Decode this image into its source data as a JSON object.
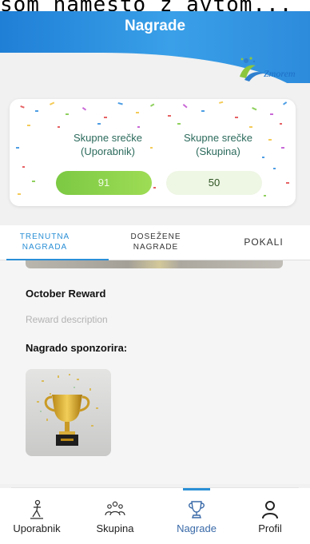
{
  "notification": {
    "text": "som namesto z avtom..."
  },
  "header": {
    "title": "Nagrade"
  },
  "logo": {
    "text": "Zmorem"
  },
  "points": {
    "user": {
      "label": "Skupne srečke\n(Uporabnik)",
      "value": "91"
    },
    "group": {
      "label": "Skupne srečke\n(Skupina)",
      "value": "50"
    }
  },
  "tabs": [
    {
      "label": "TRENUTNA\nNAGRADA",
      "active": true
    },
    {
      "label": "DOSEŽENE\nNAGRADE",
      "active": false
    },
    {
      "label": "POKALI",
      "active": false
    }
  ],
  "reward": {
    "title": "October Reward",
    "description": "Reward description",
    "sponsor_label": "Nagrado sponzorira:"
  },
  "nav": [
    {
      "label": "Uporabnik",
      "icon": "user-icon",
      "active": false
    },
    {
      "label": "Skupina",
      "icon": "group-icon",
      "active": false
    },
    {
      "label": "Nagrade",
      "icon": "trophy-icon",
      "active": true
    },
    {
      "label": "Profil",
      "icon": "profile-icon",
      "active": false
    }
  ],
  "colors": {
    "accent": "#2a8fd6",
    "header": "#2d8bdc",
    "green": "#7cc943"
  }
}
